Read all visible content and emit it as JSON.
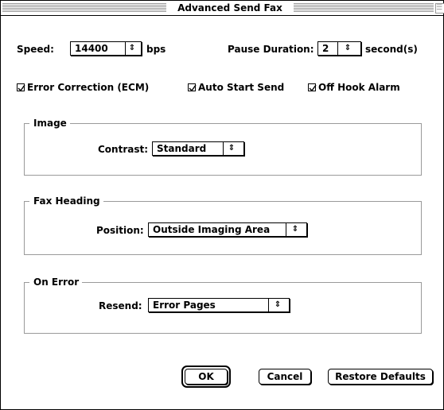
{
  "window": {
    "title": "Advanced Send Fax"
  },
  "speed": {
    "label": "Speed:",
    "value": "14400",
    "unit": "bps"
  },
  "pause": {
    "label": "Pause Duration:",
    "value": "2",
    "unit": "second(s)"
  },
  "options": {
    "ecm": {
      "label": "Error Correction (ECM)",
      "checked": true
    },
    "auto_start": {
      "label": "Auto Start Send",
      "checked": true
    },
    "off_hook": {
      "label": "Off Hook Alarm",
      "checked": true
    }
  },
  "image_group": {
    "title": "Image",
    "contrast_label": "Contrast:",
    "contrast_value": "Standard"
  },
  "heading_group": {
    "title": "Fax Heading",
    "position_label": "Position:",
    "position_value": "Outside Imaging Area"
  },
  "error_group": {
    "title": "On Error",
    "resend_label": "Resend:",
    "resend_value": "Error Pages"
  },
  "buttons": {
    "ok": "OK",
    "cancel": "Cancel",
    "restore": "Restore Defaults"
  },
  "icons": {
    "popup_arrows": "↕",
    "check": "checkmark"
  }
}
